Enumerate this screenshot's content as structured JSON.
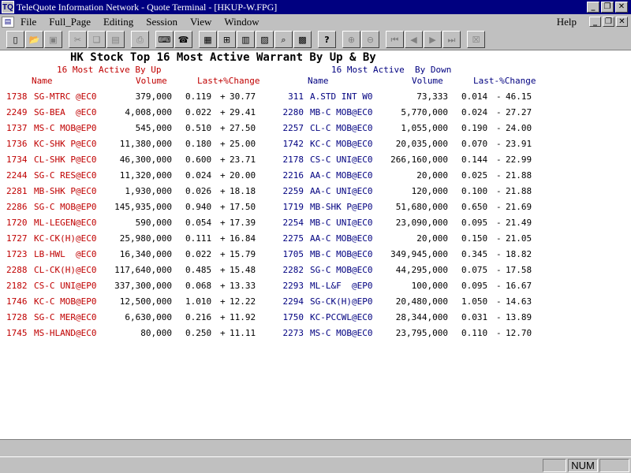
{
  "window": {
    "title": "TeleQuote Information Network - Quote Terminal - [HKUP-W.FPG]",
    "app_icon": "TQ"
  },
  "menu": {
    "items": [
      "File",
      "Full_Page",
      "Editing",
      "Session",
      "View",
      "Window"
    ],
    "help": "Help"
  },
  "toolbar": {
    "icons": [
      "new-icon",
      "open-icon",
      "save-icon",
      "cut-icon",
      "copy-icon",
      "paste-icon",
      "print-icon",
      "keyboard-icon",
      "phone-icon",
      "table-icon",
      "chart-hl-icon",
      "chart-bar-icon",
      "chart-line-icon",
      "inspect-icon",
      "calculator-icon",
      "help-icon",
      "zoom-in-icon",
      "zoom-out-icon",
      "first-icon",
      "prev-icon",
      "next-icon",
      "last-icon",
      "close-icon"
    ]
  },
  "report": {
    "title": "HK Stock Top 16 Most Active Warrant By Up & By",
    "subtitle_up": "16 Most Active By Up",
    "subtitle_down": "16 Most Active  By Down",
    "headers": {
      "name": "Name",
      "volume": "Volume",
      "change_up": "Last+%Change",
      "change_down": "Last-%Change"
    },
    "rows": [
      {
        "up": {
          "code": "1738",
          "name": "SG-MTRC @EC0",
          "vol": "379,000",
          "last": "0.119",
          "sign": "+",
          "pct": "30.77"
        },
        "down": {
          "code": "311",
          "name": "A.STD INT W0",
          "vol": "73,333",
          "last": "0.014",
          "sign": "-",
          "pct": "46.15"
        }
      },
      {
        "up": {
          "code": "2249",
          "name": "SG-BEA  @EC0",
          "vol": "4,008,000",
          "last": "0.022",
          "sign": "+",
          "pct": "29.41"
        },
        "down": {
          "code": "2280",
          "name": "MB-C MOB@EC0",
          "vol": "5,770,000",
          "last": "0.024",
          "sign": "-",
          "pct": "27.27"
        }
      },
      {
        "up": {
          "code": "1737",
          "name": "MS-C MOB@EP0",
          "vol": "545,000",
          "last": "0.510",
          "sign": "+",
          "pct": "27.50"
        },
        "down": {
          "code": "2257",
          "name": "CL-C MOB@EC0",
          "vol": "1,055,000",
          "last": "0.190",
          "sign": "-",
          "pct": "24.00"
        }
      },
      {
        "up": {
          "code": "1736",
          "name": "KC-SHK P@EC0",
          "vol": "11,380,000",
          "last": "0.180",
          "sign": "+",
          "pct": "25.00"
        },
        "down": {
          "code": "1742",
          "name": "KC-C MOB@EC0",
          "vol": "20,035,000",
          "last": "0.070",
          "sign": "-",
          "pct": "23.91"
        }
      },
      {
        "up": {
          "code": "1734",
          "name": "CL-SHK P@EC0",
          "vol": "46,300,000",
          "last": "0.600",
          "sign": "+",
          "pct": "23.71"
        },
        "down": {
          "code": "2178",
          "name": "CS-C UNI@EC0",
          "vol": "266,160,000",
          "last": "0.144",
          "sign": "-",
          "pct": "22.99"
        }
      },
      {
        "up": {
          "code": "2244",
          "name": "SG-C RES@EC0",
          "vol": "11,320,000",
          "last": "0.024",
          "sign": "+",
          "pct": "20.00"
        },
        "down": {
          "code": "2216",
          "name": "AA-C MOB@EC0",
          "vol": "20,000",
          "last": "0.025",
          "sign": "-",
          "pct": "21.88"
        }
      },
      {
        "up": {
          "code": "2281",
          "name": "MB-SHK P@EC0",
          "vol": "1,930,000",
          "last": "0.026",
          "sign": "+",
          "pct": "18.18"
        },
        "down": {
          "code": "2259",
          "name": "AA-C UNI@EC0",
          "vol": "120,000",
          "last": "0.100",
          "sign": "-",
          "pct": "21.88"
        }
      },
      {
        "up": {
          "code": "2286",
          "name": "SG-C MOB@EP0",
          "vol": "145,935,000",
          "last": "0.940",
          "sign": "+",
          "pct": "17.50"
        },
        "down": {
          "code": "1719",
          "name": "MB-SHK P@EP0",
          "vol": "51,680,000",
          "last": "0.650",
          "sign": "-",
          "pct": "21.69"
        }
      },
      {
        "up": {
          "code": "1720",
          "name": "ML-LEGEN@EC0",
          "vol": "590,000",
          "last": "0.054",
          "sign": "+",
          "pct": "17.39"
        },
        "down": {
          "code": "2254",
          "name": "MB-C UNI@EC0",
          "vol": "23,090,000",
          "last": "0.095",
          "sign": "-",
          "pct": "21.49"
        }
      },
      {
        "up": {
          "code": "1727",
          "name": "KC-CK(H)@EC0",
          "vol": "25,980,000",
          "last": "0.111",
          "sign": "+",
          "pct": "16.84"
        },
        "down": {
          "code": "2275",
          "name": "AA-C MOB@EC0",
          "vol": "20,000",
          "last": "0.150",
          "sign": "-",
          "pct": "21.05"
        }
      },
      {
        "up": {
          "code": "1723",
          "name": "LB-HWL  @EC0",
          "vol": "16,340,000",
          "last": "0.022",
          "sign": "+",
          "pct": "15.79"
        },
        "down": {
          "code": "1705",
          "name": "MB-C MOB@EC0",
          "vol": "349,945,000",
          "last": "0.345",
          "sign": "-",
          "pct": "18.82"
        }
      },
      {
        "up": {
          "code": "2288",
          "name": "CL-CK(H)@EC0",
          "vol": "117,640,000",
          "last": "0.485",
          "sign": "+",
          "pct": "15.48"
        },
        "down": {
          "code": "2282",
          "name": "SG-C MOB@EC0",
          "vol": "44,295,000",
          "last": "0.075",
          "sign": "-",
          "pct": "17.58"
        }
      },
      {
        "up": {
          "code": "2182",
          "name": "CS-C UNI@EP0",
          "vol": "337,300,000",
          "last": "0.068",
          "sign": "+",
          "pct": "13.33"
        },
        "down": {
          "code": "2293",
          "name": "ML-L&F  @EP0",
          "vol": "100,000",
          "last": "0.095",
          "sign": "-",
          "pct": "16.67"
        }
      },
      {
        "up": {
          "code": "1746",
          "name": "KC-C MOB@EP0",
          "vol": "12,500,000",
          "last": "1.010",
          "sign": "+",
          "pct": "12.22"
        },
        "down": {
          "code": "2294",
          "name": "SG-CK(H)@EP0",
          "vol": "20,480,000",
          "last": "1.050",
          "sign": "-",
          "pct": "14.63"
        }
      },
      {
        "up": {
          "code": "1728",
          "name": "SG-C MER@EC0",
          "vol": "6,630,000",
          "last": "0.216",
          "sign": "+",
          "pct": "11.92"
        },
        "down": {
          "code": "1750",
          "name": "KC-PCCWL@EC0",
          "vol": "28,344,000",
          "last": "0.031",
          "sign": "-",
          "pct": "13.89"
        }
      },
      {
        "up": {
          "code": "1745",
          "name": "MS-HLAND@EC0",
          "vol": "80,000",
          "last": "0.250",
          "sign": "+",
          "pct": "11.11"
        },
        "down": {
          "code": "2273",
          "name": "MS-C MOB@EC0",
          "vol": "23,795,000",
          "last": "0.110",
          "sign": "-",
          "pct": "12.70"
        }
      }
    ]
  },
  "status": {
    "num": "NUM"
  }
}
